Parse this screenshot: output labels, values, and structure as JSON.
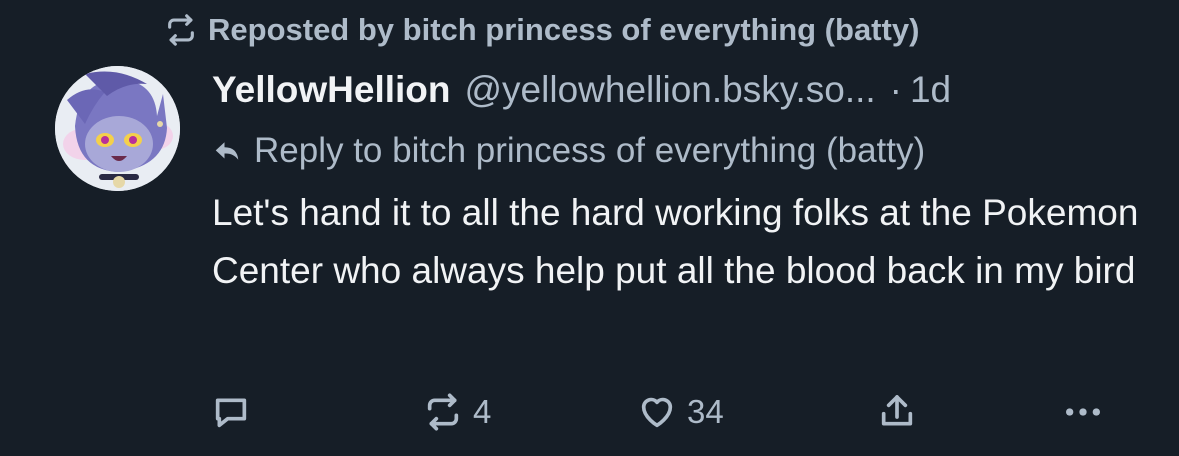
{
  "repost": {
    "icon": "repost-icon",
    "text": "Reposted by bitch princess of everything (batty)"
  },
  "author": {
    "name": "YellowHellion",
    "handle": "@yellowhellion.bsky.so...",
    "separator": "·",
    "time": "1d"
  },
  "reply": {
    "icon": "reply-arrow-icon",
    "text": "Reply to bitch princess of everything (batty)"
  },
  "post": {
    "text": "Let's hand it to all the hard working folks at the Pokemon Center who always help put all the blood back in my bird"
  },
  "actions": {
    "comment": {
      "icon": "comment-icon"
    },
    "repost": {
      "icon": "repost-icon",
      "count": "4"
    },
    "like": {
      "icon": "heart-icon",
      "count": "34"
    },
    "share": {
      "icon": "share-icon"
    },
    "more": {
      "icon": "more-icon"
    }
  },
  "colors": {
    "background": "#161e27",
    "text": "#f1f3f5",
    "muted": "#aebbc9"
  }
}
